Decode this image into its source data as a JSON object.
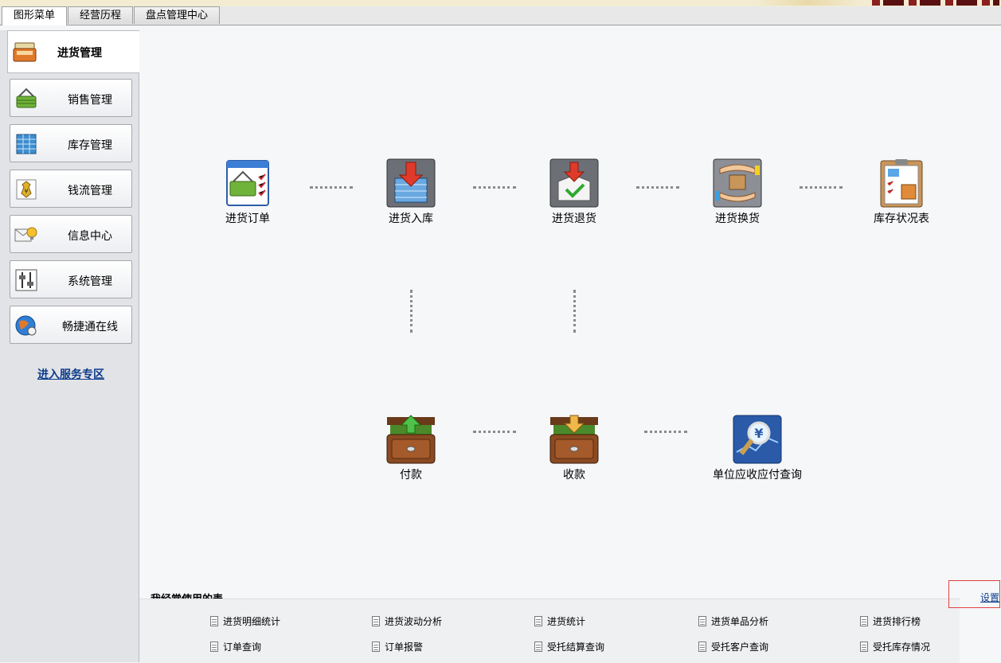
{
  "tabs": [
    {
      "label": "图形菜单",
      "active": true
    },
    {
      "label": "经营历程",
      "active": false
    },
    {
      "label": "盘点管理中心",
      "active": false
    }
  ],
  "sidebar": {
    "current": {
      "label": "进货管理",
      "icon": "cash-register-icon"
    },
    "items": [
      {
        "label": "销售管理",
        "icon": "shopping-basket-icon"
      },
      {
        "label": "库存管理",
        "icon": "shelf-grid-icon"
      },
      {
        "label": "钱流管理",
        "icon": "money-bag-icon"
      },
      {
        "label": "信息中心",
        "icon": "envelope-bulb-icon"
      },
      {
        "label": "系统管理",
        "icon": "settings-sliders-icon"
      },
      {
        "label": "畅捷通在线",
        "icon": "globe-icon"
      }
    ],
    "service_link": "进入服务专区"
  },
  "flow": {
    "row1": [
      {
        "label": "进货订单",
        "icon": "purchase-order-icon"
      },
      {
        "label": "进货入库",
        "icon": "stock-in-icon"
      },
      {
        "label": "进货退货",
        "icon": "purchase-return-icon"
      },
      {
        "label": "进货换货",
        "icon": "exchange-goods-icon"
      },
      {
        "label": "库存状况表",
        "icon": "inventory-report-icon"
      }
    ],
    "row2": [
      {
        "label": "付款",
        "icon": "payment-drawer-icon"
      },
      {
        "label": "收款",
        "icon": "receipt-drawer-icon"
      },
      {
        "label": "单位应收应付查询",
        "icon": "yen-search-icon"
      }
    ]
  },
  "favorites": {
    "title": "我经常使用的表",
    "settings_label": "设置",
    "items": [
      "进货明细统计",
      "进货波动分析",
      "进货统计",
      "进货单品分析",
      "进货排行榜",
      "订单查询",
      "订单报警",
      "受托结算查询",
      "受托客户查询",
      "受托库存情况"
    ]
  }
}
